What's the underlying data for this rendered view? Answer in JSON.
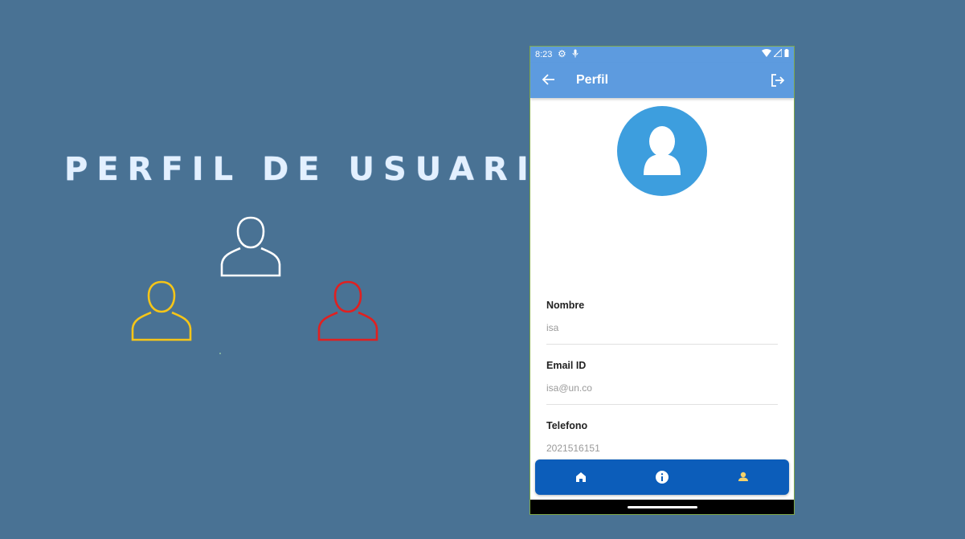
{
  "slide": {
    "title": "PERFIL DE USUARIO",
    "icons": [
      {
        "name": "user-outline-icon",
        "color": "#ffffff"
      },
      {
        "name": "user-outline-icon",
        "color": "#f5c518"
      },
      {
        "name": "user-outline-icon",
        "color": "#e02020"
      }
    ]
  },
  "phone": {
    "status_bar": {
      "time": "8:23",
      "icons": [
        "gear-icon",
        "mic-icon",
        "wifi-icon",
        "signal-icon",
        "battery-icon"
      ]
    },
    "app_bar": {
      "title": "Perfil",
      "back_icon": "arrow-left-icon",
      "logout_icon": "logout-icon"
    },
    "avatar": {
      "icon": "person-icon",
      "color": "#3d9ede"
    },
    "fields": [
      {
        "label": "Nombre",
        "value": "isa"
      },
      {
        "label": "Email ID",
        "value": "isa@un.co"
      },
      {
        "label": "Telefono",
        "value": "2021516151"
      }
    ],
    "bottom_nav": {
      "items": [
        {
          "icon": "home-icon",
          "color": "#ffffff"
        },
        {
          "icon": "info-icon",
          "color": "#ffffff"
        },
        {
          "icon": "person-icon",
          "color": "#f5d26a",
          "active": true
        }
      ]
    }
  },
  "colors": {
    "background": "#497294",
    "app_bar": "#5d9bdf",
    "bottom_nav": "#0c5dba"
  }
}
